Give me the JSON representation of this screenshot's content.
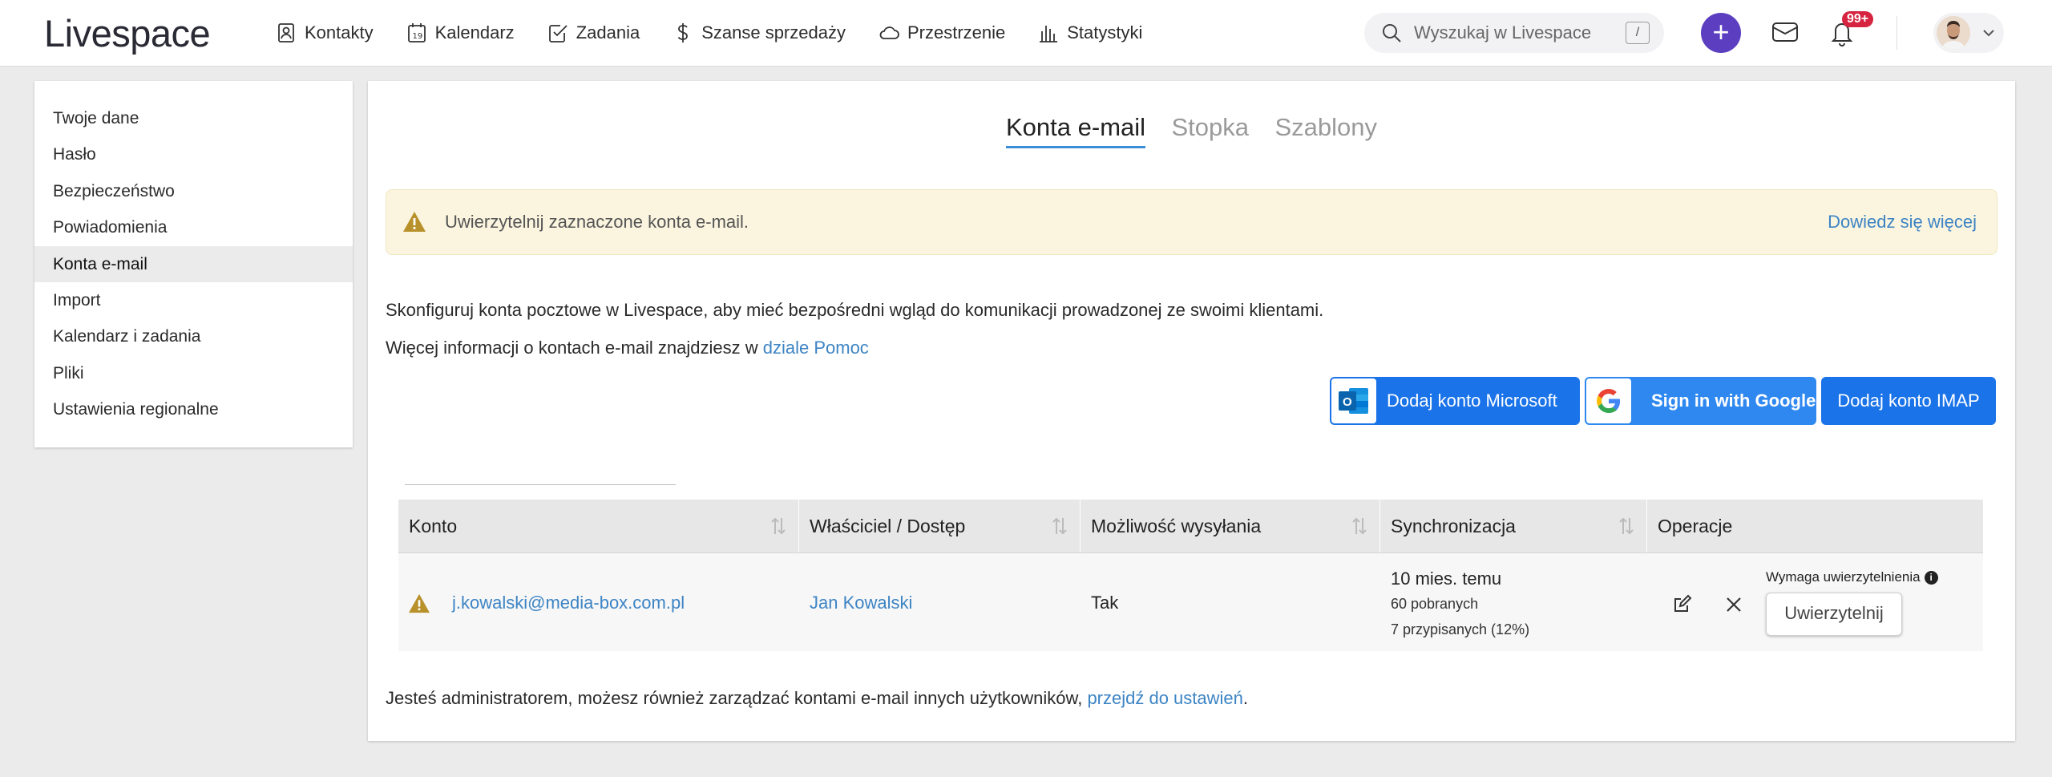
{
  "brand": {
    "logo": "Livespace"
  },
  "nav": [
    {
      "label": "Kontakty",
      "icon": "contact-icon"
    },
    {
      "label": "Kalendarz",
      "icon": "calendar-icon"
    },
    {
      "label": "Zadania",
      "icon": "task-check-icon"
    },
    {
      "label": "Szanse sprzedaży",
      "icon": "dollar-icon"
    },
    {
      "label": "Przestrzenie",
      "icon": "cloud-icon"
    },
    {
      "label": "Statystyki",
      "icon": "bar-chart-icon"
    }
  ],
  "search": {
    "placeholder": "Wyszukaj w Livespace",
    "shortcut": "/"
  },
  "header": {
    "plus": "+",
    "notifications_badge": "99+"
  },
  "sidebar": {
    "items": [
      {
        "label": "Twoje dane"
      },
      {
        "label": "Hasło"
      },
      {
        "label": "Bezpieczeństwo"
      },
      {
        "label": "Powiadomienia"
      },
      {
        "label": "Konta e-mail",
        "active": true
      },
      {
        "label": "Import"
      },
      {
        "label": "Kalendarz i zadania"
      },
      {
        "label": "Pliki"
      },
      {
        "label": "Ustawienia regionalne"
      }
    ]
  },
  "tabs": [
    {
      "label": "Konta e-mail",
      "active": true
    },
    {
      "label": "Stopka"
    },
    {
      "label": "Szablony"
    }
  ],
  "alert": {
    "message": "Uwierzytelnij zaznaczone konta e-mail.",
    "link": "Dowiedz się więcej"
  },
  "intro": {
    "line1": "Skonfiguruj konta pocztowe w Livespace, aby mieć bezpośredni wgląd do komunikacji prowadzonej ze swoimi klientami.",
    "line2_prefix": "Więcej informacji o kontach e-mail znajdziesz w ",
    "line2_link": "dziale Pomoc"
  },
  "buttons": {
    "microsoft": "Dodaj konto Microsoft",
    "google": "Sign in with Google",
    "imap": "Dodaj konto IMAP"
  },
  "table": {
    "headers": [
      "Konto",
      "Właściciel / Dostęp",
      "Możliwość wysyłania",
      "Synchronizacja",
      "Operacje"
    ],
    "rows": [
      {
        "email": "j.kowalski@media-box.com.pl",
        "owner": "Jan Kowalski",
        "can_send": "Tak",
        "sync_time": "10 mies. temu",
        "sync_fetched": "60 pobranych",
        "sync_assigned": "7 przypisanych (12%)",
        "auth_required": "Wymaga uwierzytelnienia",
        "auth_button": "Uwierzytelnij"
      }
    ]
  },
  "admin": {
    "prefix": "Jesteś administratorem, możesz również zarządzać kontami e-mail innych użytkowników, ",
    "link": "przejdź do ustawień",
    "suffix": "."
  },
  "colors": {
    "accent": "#1a73e8",
    "link": "#3d84c4",
    "plus": "#5b3fc0",
    "warning": "#b8912b",
    "alert_bg": "#fbf5df"
  }
}
